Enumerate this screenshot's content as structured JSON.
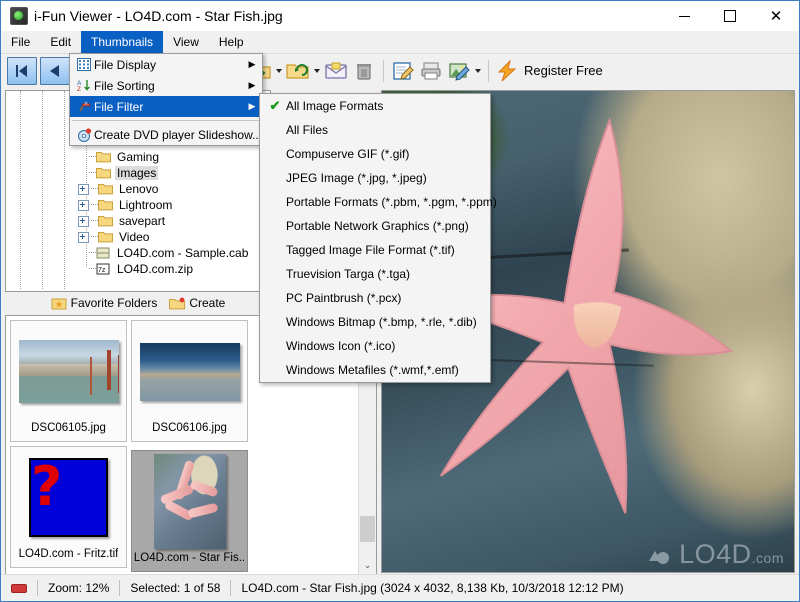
{
  "window": {
    "title": "i-Fun Viewer - LO4D.com - Star Fish.jpg",
    "app_icon": "app-icon",
    "minimize": "—",
    "maximize": "□",
    "close": "✕"
  },
  "menubar": {
    "items": [
      {
        "label": "File",
        "active": false
      },
      {
        "label": "Edit",
        "active": false
      },
      {
        "label": "Thumbnails",
        "active": true
      },
      {
        "label": "View",
        "active": false
      },
      {
        "label": "Help",
        "active": false
      }
    ]
  },
  "toolbar": {
    "buttons": [
      {
        "name": "first-image-button",
        "icon": "first-icon"
      },
      {
        "name": "previous-image-button",
        "icon": "previous-icon"
      },
      {
        "name": "zoom-in-button",
        "icon": "zoom-in-icon"
      },
      {
        "name": "zoom-out-button",
        "icon": "zoom-out-icon"
      },
      {
        "name": "fit-to-window-button",
        "icon": "fit-window-icon"
      },
      {
        "name": "slideshow-button",
        "icon": "stopwatch-icon"
      },
      {
        "name": "rename-button",
        "icon": "rename-ab-icon"
      },
      {
        "name": "move-to-folder-button",
        "icon": "folder-move-icon"
      },
      {
        "name": "copy-to-folder-button",
        "icon": "folder-copy-icon"
      },
      {
        "name": "email-button",
        "icon": "envelope-icon"
      },
      {
        "name": "delete-button",
        "icon": "trash-icon"
      },
      {
        "name": "edit-notes-button",
        "icon": "note-edit-icon"
      },
      {
        "name": "print-button",
        "icon": "printer-icon"
      },
      {
        "name": "image-editor-button",
        "icon": "image-edit-icon"
      }
    ],
    "register_label": "Register Free",
    "register_icon": "lightning-icon"
  },
  "thumbnails_menu": {
    "items": [
      {
        "label": "File Display",
        "icon": "grid-icon",
        "submenu": true,
        "highlighted": false
      },
      {
        "label": "File Sorting",
        "icon": "sort-az-icon",
        "submenu": true,
        "highlighted": false
      },
      {
        "label": "File Filter",
        "icon": "filter-icon",
        "submenu": true,
        "highlighted": true
      },
      {
        "separator": true
      },
      {
        "label": "Create DVD player Slideshow...",
        "icon": "dvd-icon",
        "submenu": false,
        "highlighted": false
      }
    ],
    "submenu_arrow": "▶"
  },
  "file_filter_menu": {
    "checkmark": "✔",
    "items": [
      {
        "label": "All Image Formats",
        "checked": true
      },
      {
        "label": "All Files",
        "checked": false
      },
      {
        "label": "Compuserve GIF (*.gif)",
        "checked": false
      },
      {
        "label": "JPEG Image (*.jpg, *.jpeg)",
        "checked": false
      },
      {
        "label": "Portable Formats (*.pbm, *.pgm, *.ppm)",
        "checked": false
      },
      {
        "label": "Portable Network Graphics (*.png)",
        "checked": false
      },
      {
        "label": "Tagged Image File Format (*.tif)",
        "checked": false
      },
      {
        "label": "Truevision Targa (*.tga)",
        "checked": false
      },
      {
        "label": "PC Paintbrush (*.pcx)",
        "checked": false
      },
      {
        "label": "Windows Bitmap (*.bmp, *.rle, *.dib)",
        "checked": false
      },
      {
        "label": "Windows Icon (*.ico)",
        "checked": false
      },
      {
        "label": "Windows Metafiles (*.wmf,*.emf)",
        "checked": false
      }
    ]
  },
  "folder_tree": {
    "items": [
      {
        "label": "Gaming",
        "expander": "none",
        "icon": "folder-icon",
        "selected": false
      },
      {
        "label": "Images",
        "expander": "none",
        "icon": "folder-icon",
        "selected": true
      },
      {
        "label": "Lenovo",
        "expander": "plus",
        "icon": "folder-icon",
        "selected": false
      },
      {
        "label": "Lightroom",
        "expander": "plus",
        "icon": "folder-icon",
        "selected": false
      },
      {
        "label": "savepart",
        "expander": "plus",
        "icon": "folder-icon",
        "selected": false
      },
      {
        "label": "Video",
        "expander": "plus",
        "icon": "folder-icon",
        "selected": false
      },
      {
        "label": "LO4D.com - Sample.cab",
        "expander": "none",
        "icon": "cab-icon",
        "selected": false
      },
      {
        "label": "LO4D.com.zip",
        "expander": "none",
        "icon": "zip-icon",
        "selected": false
      }
    ]
  },
  "favorites_bar": {
    "items": [
      {
        "label": "Favorite Folders",
        "icon": "star-folder-icon"
      },
      {
        "label": "Create",
        "icon": "new-folder-icon"
      }
    ]
  },
  "thumbnails": {
    "items": [
      {
        "name": "DSC06105.jpg",
        "art": "bridge",
        "selected": false
      },
      {
        "name": "DSC06106.jpg",
        "art": "lisbon",
        "selected": false
      },
      {
        "name": "LO4D.com - Fritz.tif",
        "art": "fritz",
        "selected": false,
        "art_glyph": "?"
      },
      {
        "name": "LO4D.com - Star Fis..",
        "art": "star",
        "selected": true
      }
    ]
  },
  "preview": {
    "watermark": "LO4D",
    "watermark_suffix": ".com",
    "alt": "Star fish in tide pool"
  },
  "statusbar": {
    "stop_icon": "stop-icon",
    "zoom": "Zoom: 12%",
    "selected": "Selected: 1 of 58",
    "file_info": "LO4D.com - Star Fish.jpg  (3024 x 4032, 8,138 Kb, 10/3/2018 12:12 PM)"
  },
  "scrollbars": {
    "down_arrow": "⌄",
    "up_arrow": "⌃"
  },
  "colors": {
    "menu_highlight": "#0a5fc2",
    "window_border": "#3a7fc4",
    "checkmark_green": "#1a9b1a",
    "stop_red": "#d23a3a"
  }
}
